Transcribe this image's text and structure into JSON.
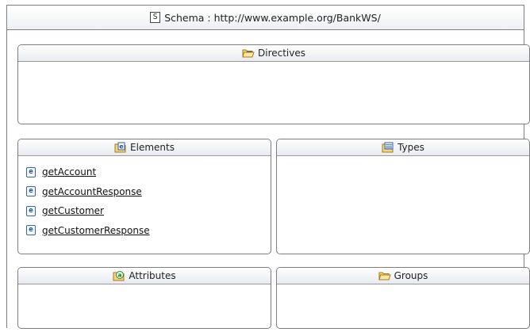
{
  "schema": {
    "icon": "schema-icon",
    "icon_letter": "S",
    "title": "Schema : http://www.example.org/BankWS/"
  },
  "panels": {
    "directives": {
      "label": "Directives",
      "icon": "folder-open-icon"
    },
    "elements": {
      "label": "Elements",
      "icon": "element-folder-icon",
      "item_icon_letter": "e",
      "items": [
        {
          "label": "getAccount"
        },
        {
          "label": "getAccountResponse"
        },
        {
          "label": "getCustomer"
        },
        {
          "label": "getCustomerResponse"
        }
      ]
    },
    "types": {
      "label": "Types",
      "icon": "types-folder-icon"
    },
    "attributes": {
      "label": "Attributes",
      "icon": "attribute-folder-icon"
    },
    "groups": {
      "label": "Groups",
      "icon": "groups-folder-icon"
    }
  },
  "colors": {
    "border": "#7d7d7d",
    "header_gradient_end": "#e8ebf0",
    "element_badge": "#1f4f9c",
    "folder": "#f3c55a"
  }
}
